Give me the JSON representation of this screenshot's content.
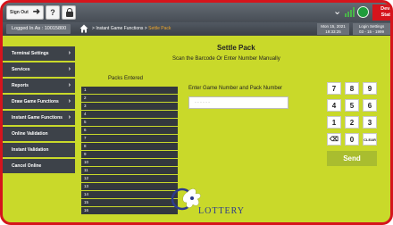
{
  "topbar": {
    "logout_label": "Sign Out",
    "help_label": "?",
    "device_status_label": "Device Status",
    "colors": {
      "bar": "#4f555d",
      "alert": "#d5141c",
      "online": "#1f9c3c"
    }
  },
  "subbar": {
    "login_info": "Logged In As : 10015800",
    "breadcrumb_prefix": "Instant Game Functions",
    "breadcrumb_sep": ">",
    "breadcrumb_current": "Settle Pack",
    "date_line1": "Mon 15, 2021",
    "date_line2": "19:33:25",
    "lastlog_line1": "Login Settings",
    "lastlog_line2": "03 - 15 - 1999"
  },
  "sidebar": {
    "items": [
      {
        "label": "Terminal Settings",
        "caret": "›"
      },
      {
        "label": "Services",
        "caret": "›"
      },
      {
        "label": "Reports",
        "caret": "›"
      },
      {
        "label": "Draw Game Functions",
        "caret": "›"
      },
      {
        "label": "Instant Game Functions",
        "caret": "›"
      },
      {
        "label": "Online Validation",
        "caret": ""
      },
      {
        "label": "Instant Validation",
        "caret": ""
      },
      {
        "label": "Cancel Online",
        "caret": ""
      }
    ]
  },
  "main": {
    "title": "Settle Pack",
    "subtitle": "Scan the Barcode Or Enter Number Manually",
    "packs_title": "Packs Entered",
    "pack_rows": [
      "1",
      "2",
      "3",
      "4",
      "5",
      "6",
      "7",
      "8",
      "9",
      "10",
      "11",
      "12",
      "13",
      "14",
      "15",
      "16"
    ],
    "input_label": "Enter Game Number and Pack Number",
    "input_placeholder": "- - - - - -"
  },
  "keypad": {
    "keys": [
      "7",
      "8",
      "9",
      "4",
      "5",
      "6",
      "1",
      "2",
      "3",
      "⌫",
      "0",
      "CLEAR"
    ],
    "send_label": "Send"
  },
  "logo": {
    "text": "LOTTERY"
  }
}
